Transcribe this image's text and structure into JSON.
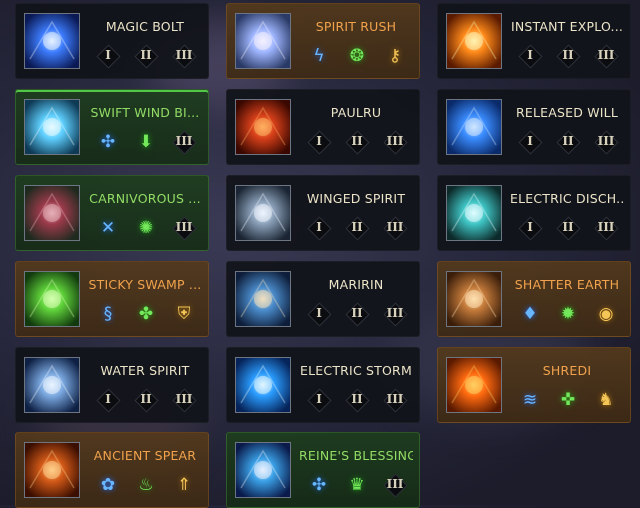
{
  "cards": [
    {
      "title": "MAGIC BOLT",
      "style": "normal",
      "slots": [
        {
          "kind": "roman",
          "label": "I"
        },
        {
          "kind": "roman",
          "label": "II"
        },
        {
          "kind": "roman",
          "label": "III"
        }
      ]
    },
    {
      "title": "SPIRIT RUSH",
      "style": "orange",
      "slots": [
        {
          "kind": "rune",
          "icon": "lightning-rune-icon",
          "glyph": "ϟ",
          "color": "blue"
        },
        {
          "kind": "rune",
          "icon": "spirit-orb-rune-icon",
          "glyph": "❂",
          "color": "green"
        },
        {
          "kind": "rune",
          "icon": "key-rune-icon",
          "glyph": "⚷",
          "color": "gold"
        }
      ]
    },
    {
      "title": "INSTANT EXPLO...",
      "style": "normal",
      "slots": [
        {
          "kind": "roman",
          "label": "I"
        },
        {
          "kind": "roman",
          "label": "II"
        },
        {
          "kind": "roman",
          "label": "III"
        }
      ]
    },
    {
      "title": "SWIFT WIND BI...",
      "style": "green",
      "selected": true,
      "slots": [
        {
          "kind": "rune",
          "icon": "orbit-rune-icon",
          "glyph": "✣",
          "color": "blue"
        },
        {
          "kind": "rune",
          "icon": "arrow-down-rune-icon",
          "glyph": "⬇",
          "color": "green"
        },
        {
          "kind": "roman",
          "label": "III"
        }
      ]
    },
    {
      "title": "PAULRU",
      "style": "normal",
      "slots": [
        {
          "kind": "roman",
          "label": "I"
        },
        {
          "kind": "roman",
          "label": "II"
        },
        {
          "kind": "roman",
          "label": "III"
        }
      ]
    },
    {
      "title": "RELEASED WILL",
      "style": "normal",
      "slots": [
        {
          "kind": "roman",
          "label": "I"
        },
        {
          "kind": "roman",
          "label": "II"
        },
        {
          "kind": "roman",
          "label": "III"
        }
      ]
    },
    {
      "title": "CARNIVOROUS ...",
      "style": "green",
      "slots": [
        {
          "kind": "rune",
          "icon": "crossed-blades-rune-icon",
          "glyph": "✕",
          "color": "blue"
        },
        {
          "kind": "rune",
          "icon": "burst-rune-icon",
          "glyph": "✺",
          "color": "green"
        },
        {
          "kind": "roman",
          "label": "III"
        }
      ]
    },
    {
      "title": "WINGED SPIRIT",
      "style": "normal",
      "slots": [
        {
          "kind": "roman",
          "label": "I"
        },
        {
          "kind": "roman",
          "label": "II"
        },
        {
          "kind": "roman",
          "label": "III"
        }
      ]
    },
    {
      "title": "ELECTRIC DISCH...",
      "style": "normal",
      "slots": [
        {
          "kind": "roman",
          "label": "I"
        },
        {
          "kind": "roman",
          "label": "II"
        },
        {
          "kind": "roman",
          "label": "III"
        }
      ]
    },
    {
      "title": "STICKY SWAMP ...",
      "style": "orange",
      "slots": [
        {
          "kind": "rune",
          "icon": "vortex-rune-icon",
          "glyph": "§",
          "color": "blue"
        },
        {
          "kind": "rune",
          "icon": "sprout-rune-icon",
          "glyph": "✤",
          "color": "green"
        },
        {
          "kind": "rune",
          "icon": "shield-rune-icon",
          "glyph": "⛨",
          "color": "gold"
        }
      ]
    },
    {
      "title": "MARIRIN",
      "style": "normal",
      "slots": [
        {
          "kind": "roman",
          "label": "I"
        },
        {
          "kind": "roman",
          "label": "II"
        },
        {
          "kind": "roman",
          "label": "III"
        }
      ]
    },
    {
      "title": "SHATTER EARTH",
      "style": "orange",
      "slots": [
        {
          "kind": "rune",
          "icon": "droplet-rune-icon",
          "glyph": "♦",
          "color": "blue"
        },
        {
          "kind": "rune",
          "icon": "spark-rune-icon",
          "glyph": "✹",
          "color": "green"
        },
        {
          "kind": "rune",
          "icon": "orb-rune-icon",
          "glyph": "◉",
          "color": "gold"
        }
      ]
    },
    {
      "title": "WATER SPIRIT",
      "style": "normal",
      "slots": [
        {
          "kind": "roman",
          "label": "I"
        },
        {
          "kind": "roman",
          "label": "II"
        },
        {
          "kind": "roman",
          "label": "III"
        }
      ]
    },
    {
      "title": "ELECTRIC STORM",
      "style": "normal",
      "slots": [
        {
          "kind": "roman",
          "label": "I"
        },
        {
          "kind": "roman",
          "label": "II"
        },
        {
          "kind": "roman",
          "label": "III"
        }
      ]
    },
    {
      "title": "SHREDI",
      "style": "orange",
      "slots": [
        {
          "kind": "rune",
          "icon": "wave-rune-icon",
          "glyph": "≋",
          "color": "blue"
        },
        {
          "kind": "rune",
          "icon": "arrows-rune-icon",
          "glyph": "✜",
          "color": "green"
        },
        {
          "kind": "rune",
          "icon": "beast-rune-icon",
          "glyph": "♞",
          "color": "gold"
        }
      ]
    },
    {
      "title": "ANCIENT SPEAR",
      "style": "orange",
      "slots": [
        {
          "kind": "rune",
          "icon": "swirl-rune-icon",
          "glyph": "✿",
          "color": "blue"
        },
        {
          "kind": "rune",
          "icon": "flame-rune-icon",
          "glyph": "♨",
          "color": "green"
        },
        {
          "kind": "rune",
          "icon": "arrow-up-rune-icon",
          "glyph": "⇑",
          "color": "gold"
        }
      ]
    },
    {
      "title": "REINE'S BLESSING",
      "style": "green",
      "slots": [
        {
          "kind": "rune",
          "icon": "orbit-rune-icon",
          "glyph": "✣",
          "color": "blue"
        },
        {
          "kind": "rune",
          "icon": "crown-rune-icon",
          "glyph": "♛",
          "color": "green"
        },
        {
          "kind": "roman",
          "label": "III"
        }
      ]
    }
  ],
  "colors": {
    "normal_title": "#ece4c8",
    "orange_title": "#f1a24c",
    "green_title": "#92dc65",
    "selected_accent": "#52c646"
  }
}
